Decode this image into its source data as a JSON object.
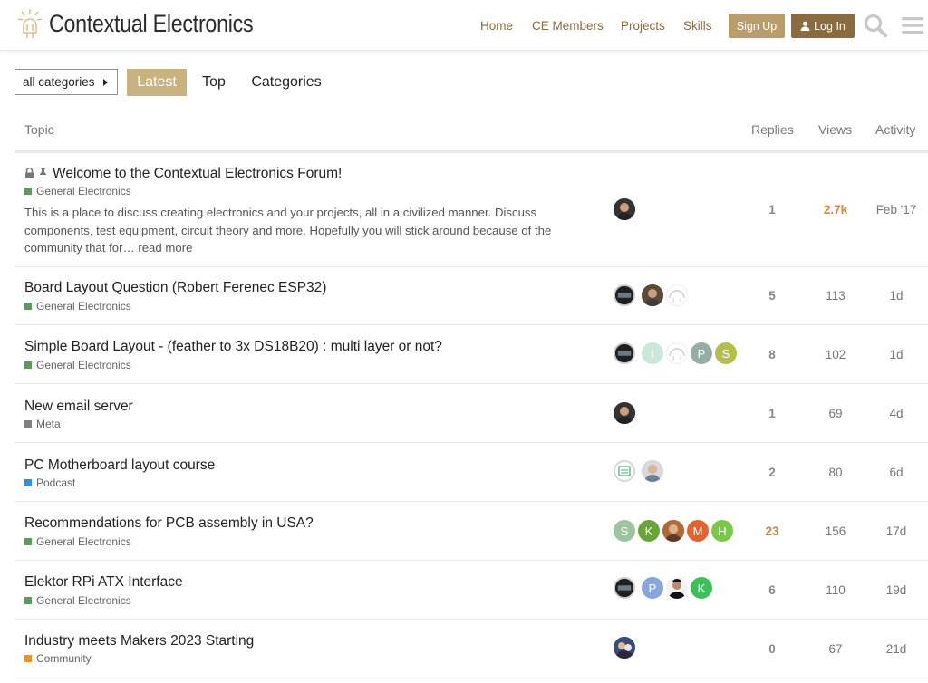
{
  "header": {
    "brand": "Contextual Electronics",
    "nav": [
      "Home",
      "CE Members",
      "Projects",
      "Skills"
    ],
    "signup_label": "Sign Up",
    "login_label": "Log In"
  },
  "filters": {
    "category_select": "all categories",
    "tabs": [
      "Latest",
      "Top",
      "Categories"
    ]
  },
  "table": {
    "columns": [
      "Topic",
      "Replies",
      "Views",
      "Activity"
    ],
    "topics": [
      {
        "title": "Welcome to the Contextual Electronics Forum!",
        "category": "General Electronics",
        "category_color": "#5b9b5f",
        "excerpt": "This is a place to discuss creating electronics and your projects, all in a civilized manner. Discuss components, test equipment, circuit theory and more. Hopefully you will stick around because of the community that for… read more",
        "replies": "1",
        "views": "2.7k",
        "activity": "Feb '17",
        "posters": [
          "photo"
        ]
      },
      {
        "title": "Board Layout Question (Robert Ferenec ESP32)",
        "category": "General Electronics",
        "category_color": "#5b9b5f",
        "replies": "5",
        "views": "113",
        "activity": "1d",
        "posters": [
          "photo",
          "photo",
          "logo"
        ]
      },
      {
        "title": "Simple Board Layout - (feather to 3x DS18B20) : multi layer or not?",
        "category": "General Electronics",
        "category_color": "#5b9b5f",
        "replies": "8",
        "views": "102",
        "activity": "1d",
        "posters": [
          "photo",
          "I",
          "logo",
          "P",
          "S"
        ]
      },
      {
        "title": "New email server",
        "category": "Meta",
        "category_color": "#808080",
        "replies": "1",
        "views": "69",
        "activity": "4d",
        "posters": [
          "photo"
        ]
      },
      {
        "title": "PC Motherboard layout course",
        "category": "Podcast",
        "category_color": "#3a8fd1",
        "replies": "2",
        "views": "80",
        "activity": "6d",
        "posters": [
          "logo",
          "photo"
        ]
      },
      {
        "title": "Recommendations for PCB assembly in USA?",
        "category": "General Electronics",
        "category_color": "#5b9b5f",
        "replies": "23",
        "views": "156",
        "activity": "17d",
        "posters": [
          "S",
          "K",
          "photo",
          "M",
          "H"
        ]
      },
      {
        "title": "Elektor RPi ATX Interface",
        "category": "General Electronics",
        "category_color": "#5b9b5f",
        "replies": "6",
        "views": "110",
        "activity": "19d",
        "posters": [
          "photo",
          "P",
          "photo",
          "K"
        ]
      },
      {
        "title": "Industry meets Makers 2023 Starting",
        "category": "Community",
        "category_color": "#f0921e",
        "replies": "0",
        "views": "67",
        "activity": "21d",
        "posters": [
          "photo"
        ]
      }
    ]
  },
  "colors": {
    "accent": "#8a6a3f",
    "accent_light": "#c9b27e",
    "hot_number": "#d08a3c"
  }
}
